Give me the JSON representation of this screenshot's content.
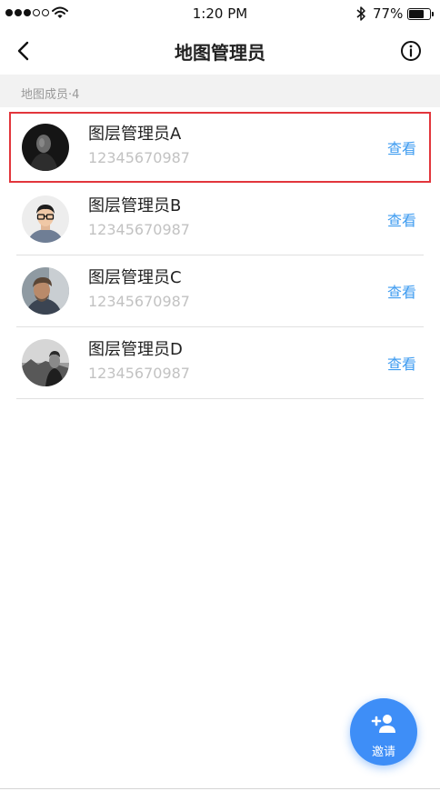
{
  "status_bar": {
    "time": "1:20 PM",
    "battery_percent": "77%",
    "battery_level": 0.77,
    "signal_bars_filled": 3,
    "signal_bars_total": 5
  },
  "nav": {
    "title": "地图管理员",
    "back_icon": "chevron-left-icon",
    "info_icon": "info-circle-icon"
  },
  "section": {
    "label": "地图成员·4"
  },
  "members": [
    {
      "name": "图层管理员A",
      "phone": "12345670987",
      "action": "查看",
      "selected": true
    },
    {
      "name": "图层管理员B",
      "phone": "12345670987",
      "action": "查看",
      "selected": false
    },
    {
      "name": "图层管理员C",
      "phone": "12345670987",
      "action": "查看",
      "selected": false
    },
    {
      "name": "图层管理员D",
      "phone": "12345670987",
      "action": "查看",
      "selected": false
    }
  ],
  "invite": {
    "label": "邀请",
    "icon": "add-person-icon"
  },
  "colors": {
    "accent": "#3e8ef7",
    "link": "#3d9bf0",
    "highlight_border": "#e2353c",
    "section_bg": "#f2f2f2",
    "secondary_text": "#c2c2c2"
  }
}
